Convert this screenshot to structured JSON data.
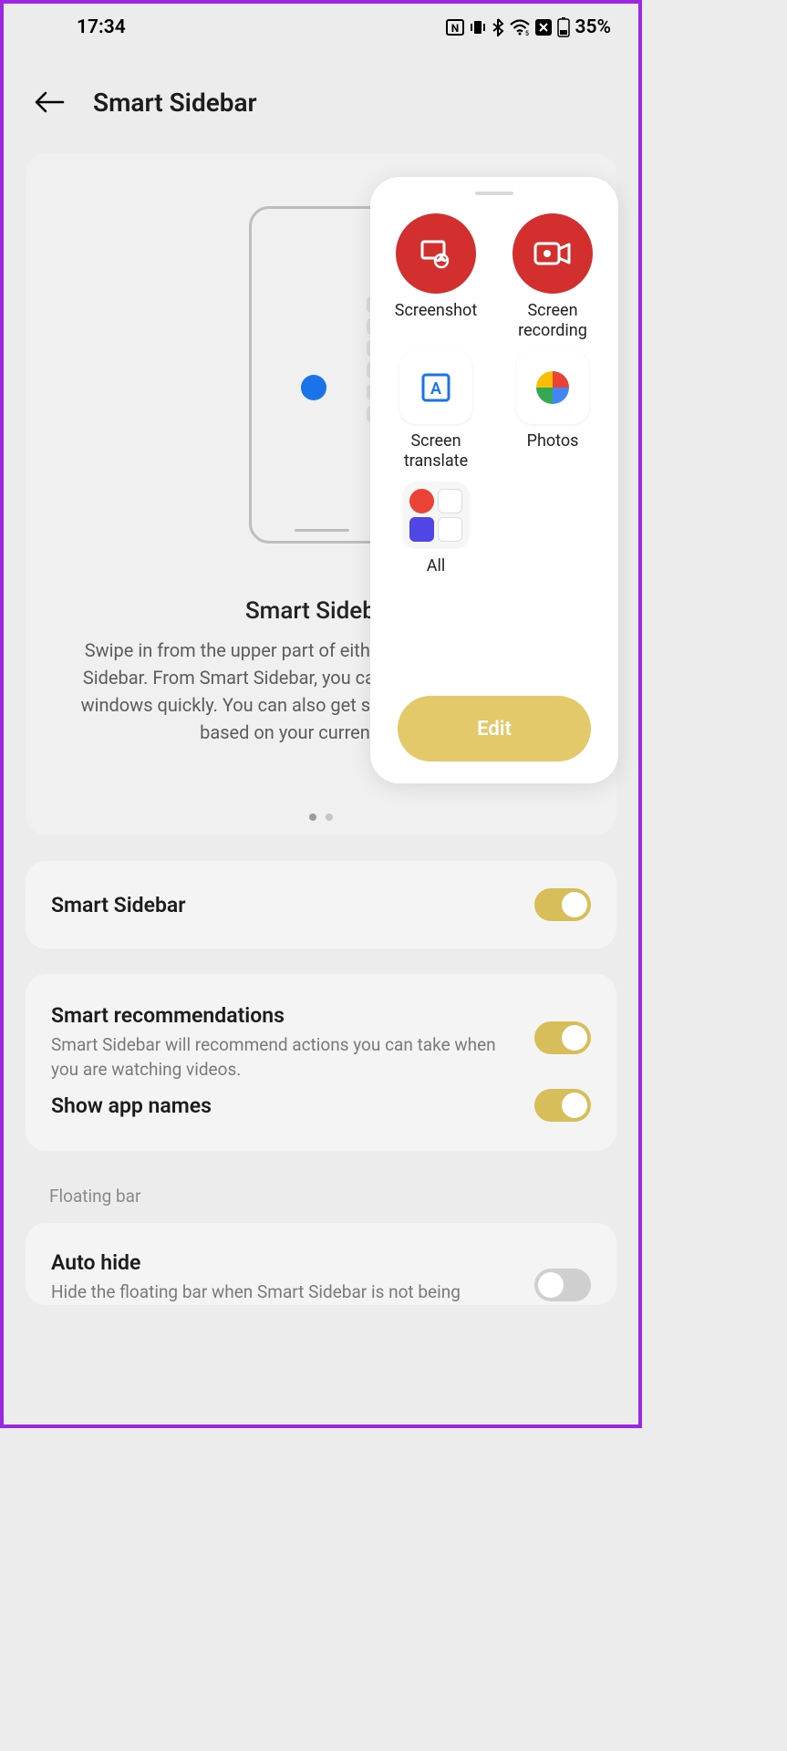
{
  "status": {
    "time": "17:34",
    "battery": "35%"
  },
  "header": {
    "title": "Smart Sidebar"
  },
  "preview": {
    "title": "Smart Sidebar",
    "desc": "Swipe in from the upper part of either side to pull up Smart Sidebar. From Smart Sidebar, you can open apps in floating windows quickly. You can also get smart recommendations based on your current activity."
  },
  "panel": {
    "items": [
      {
        "label": "Screenshot"
      },
      {
        "label": "Screen recording"
      },
      {
        "label": "Screen translate"
      },
      {
        "label": "Photos"
      },
      {
        "label": "All"
      }
    ],
    "edit": "Edit"
  },
  "settings": [
    {
      "title": "Smart Sidebar"
    },
    {
      "title": "Smart recommendations",
      "desc": "Smart Sidebar will recommend actions you can take when you are watching videos."
    },
    {
      "title": "Show app names"
    }
  ],
  "section": "Floating bar",
  "autohide": {
    "title": "Auto hide",
    "desc": "Hide the floating bar when Smart Sidebar is not being"
  }
}
